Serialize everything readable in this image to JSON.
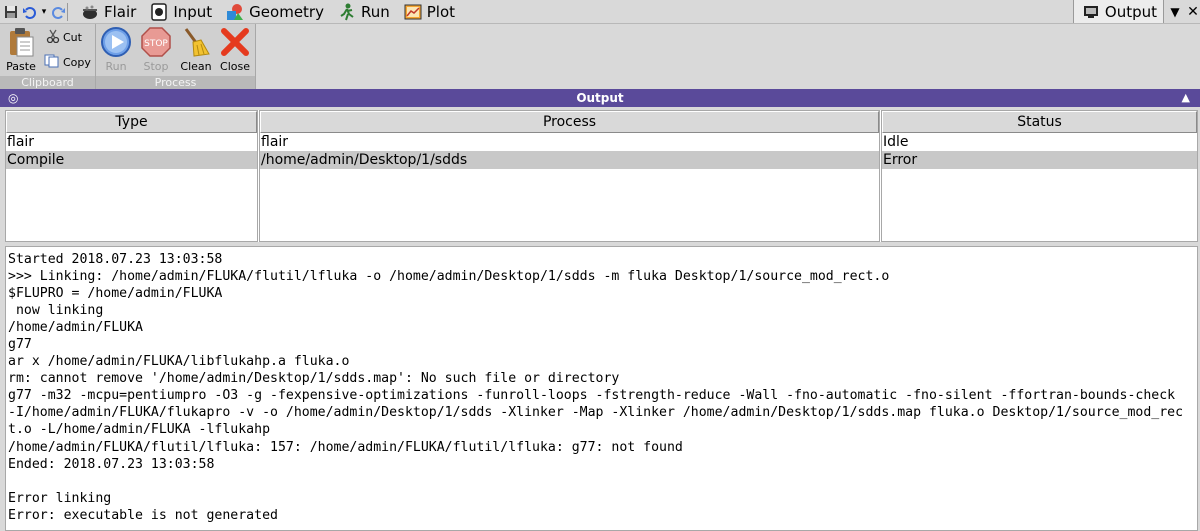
{
  "topbar": {
    "tabs": [
      {
        "label": "Flair",
        "icon": "flair-cauldron-icon"
      },
      {
        "label": "Input",
        "icon": "input-card-icon"
      },
      {
        "label": "Geometry",
        "icon": "geometry-shapes-icon"
      },
      {
        "label": "Run",
        "icon": "run-figure-icon"
      },
      {
        "label": "Plot",
        "icon": "plot-chart-icon"
      }
    ],
    "active_tab": {
      "label": "Output",
      "icon": "output-monitor-icon"
    }
  },
  "ribbon": {
    "clipboard": {
      "label": "Clipboard",
      "paste": "Paste",
      "cut": "Cut",
      "copy": "Copy"
    },
    "process": {
      "label": "Process",
      "run": "Run",
      "stop": "Stop",
      "clean": "Clean",
      "close": "Close"
    }
  },
  "output_header": {
    "title": "Output",
    "collapse_glyph": "▲",
    "pin_glyph": "◎"
  },
  "table": {
    "columns": [
      "Type",
      "Process",
      "Status"
    ],
    "rows": [
      {
        "type": "flair",
        "process": "flair",
        "status": "Idle"
      },
      {
        "type": "Compile",
        "process": "/home/admin/Desktop/1/sdds",
        "status": "Error"
      }
    ]
  },
  "log": {
    "lines": [
      "Started 2018.07.23 13:03:58",
      ">>> Linking: /home/admin/FLUKA/flutil/lfluka -o /home/admin/Desktop/1/sdds -m fluka Desktop/1/source_mod_rect.o",
      "$FLUPRO = /home/admin/FLUKA",
      " now linking",
      "/home/admin/FLUKA",
      "g77",
      "ar x /home/admin/FLUKA/libflukahp.a fluka.o",
      "rm: cannot remove '/home/admin/Desktop/1/sdds.map': No such file or directory",
      "g77 -m32 -mcpu=pentiumpro -O3 -g -fexpensive-optimizations -funroll-loops -fstrength-reduce -Wall -fno-automatic -fno-silent -ffortran-bounds-check",
      "-I/home/admin/FLUKA/flukapro -v -o /home/admin/Desktop/1/sdds -Xlinker -Map -Xlinker /home/admin/Desktop/1/sdds.map fluka.o Desktop/1/source_mod_rec",
      "t.o -L/home/admin/FLUKA -lflukahp",
      "/home/admin/FLUKA/flutil/lfluka: 157: /home/admin/FLUKA/flutil/lfluka: g77: not found",
      "Ended: 2018.07.23 13:03:58",
      "",
      "Error linking",
      "Error: executable is not generated"
    ]
  },
  "colors": {
    "header_bg": "#5a4a9a",
    "selected_row": "#c8c8c8",
    "stop_red": "#d8322a",
    "close_red": "#e53a1e",
    "run_blue": "#3a7bd5"
  }
}
